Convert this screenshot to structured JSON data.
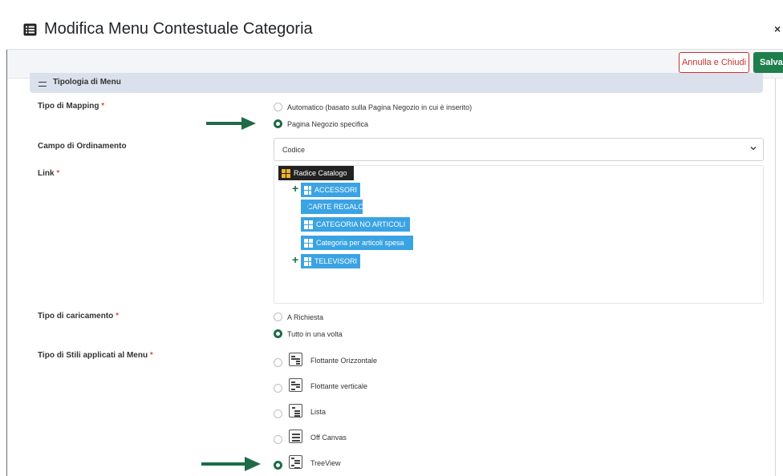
{
  "modal": {
    "title": "Modifica Menu Contestuale Categoria",
    "close": "×"
  },
  "toolbar": {
    "cancel_label": "Annulla e Chiudi",
    "save_label": "Salva"
  },
  "section": {
    "title": "Tipologia di Menu"
  },
  "mapping": {
    "label": "Tipo di Mapping",
    "required": "*",
    "options": [
      {
        "label": "Automatico (basato sulla Pagina Negozio in cui è inserito)",
        "selected": false
      },
      {
        "label": "Pagina Negozio specifica",
        "selected": true
      }
    ]
  },
  "ordering": {
    "label": "Campo di Ordinamento",
    "value": "Codice"
  },
  "link": {
    "label": "Link",
    "required": "*",
    "tree": {
      "root": "Radice Catalogo",
      "children": [
        {
          "label": "ACCESSORI",
          "expandable": true
        },
        {
          "label": "CARTE REGALO",
          "expandable": false
        },
        {
          "label": "CATEGORIA NO ARTICOLI",
          "expandable": false
        },
        {
          "label": "Categoria per articoli spesa",
          "expandable": false
        },
        {
          "label": "TELEVISORI",
          "expandable": true
        }
      ]
    }
  },
  "loading": {
    "label": "Tipo di caricamento",
    "required": "*",
    "options": [
      {
        "label": "A Richiesta",
        "selected": false
      },
      {
        "label": "Tutto in una volta",
        "selected": true
      }
    ]
  },
  "styles": {
    "label": "Tipo di Stili applicati al Menu",
    "required": "*",
    "options": [
      {
        "label": "Flottante Orizzontale",
        "icon": "horizontal-menu-icon",
        "selected": false
      },
      {
        "label": "Flottante verticale",
        "icon": "vertical-menu-icon",
        "selected": false
      },
      {
        "label": "Lista",
        "icon": "list-menu-icon",
        "selected": false
      },
      {
        "label": "Off Canvas",
        "icon": "off-canvas-icon",
        "selected": false
      },
      {
        "label": "TreeView",
        "icon": "treeview-icon",
        "selected": true
      }
    ]
  },
  "colors": {
    "accent": "#1e7e4c",
    "danger": "#c9302c",
    "tree_node": "#3aa3e3",
    "section_bg": "#dbe1ec"
  }
}
